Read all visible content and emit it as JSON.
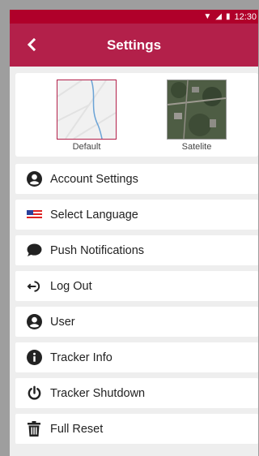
{
  "status_bar": {
    "time": "12:30"
  },
  "app_bar": {
    "title": "Settings"
  },
  "map_types": [
    {
      "label": "Default",
      "selected": true
    },
    {
      "label": "Satelite",
      "selected": false
    }
  ],
  "menu": [
    {
      "label": "Account Settings",
      "icon": "account-circle-icon"
    },
    {
      "label": "Select Language",
      "icon": "us-flag-icon"
    },
    {
      "label": "Push Notifications",
      "icon": "chat-bubble-icon"
    },
    {
      "label": "Log Out",
      "icon": "logout-icon"
    },
    {
      "label": "User",
      "icon": "account-circle-icon"
    },
    {
      "label": "Tracker Info",
      "icon": "info-icon"
    },
    {
      "label": "Tracker Shutdown",
      "icon": "power-icon"
    },
    {
      "label": "Full Reset",
      "icon": "trash-icon"
    }
  ],
  "colors": {
    "status_bar": "#b0002a",
    "app_bar": "#b3204a"
  }
}
